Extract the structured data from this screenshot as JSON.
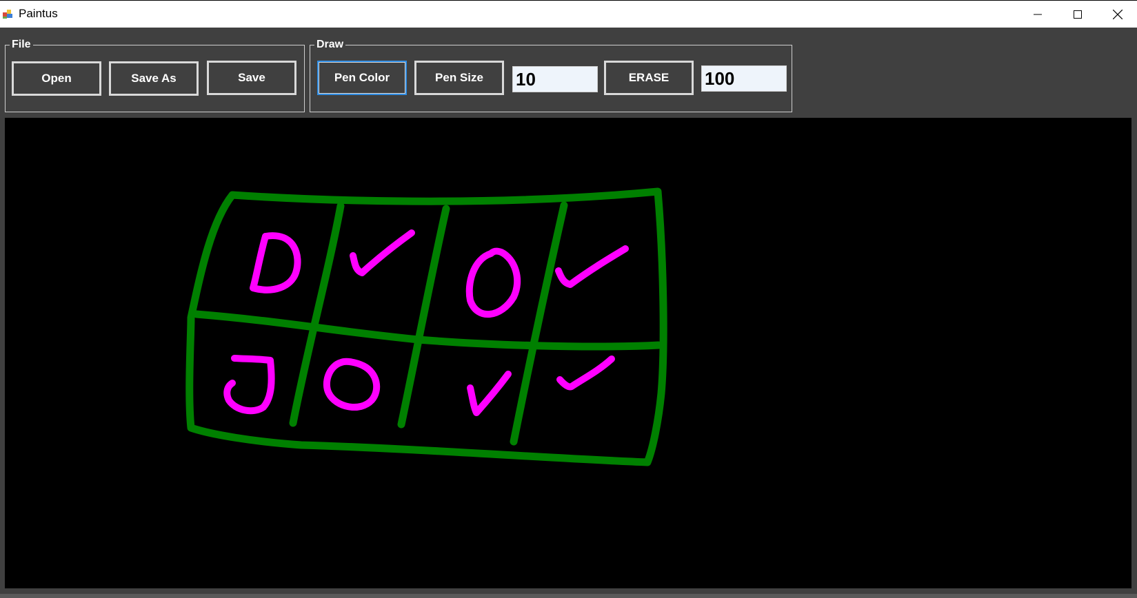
{
  "window": {
    "title": "Paintus",
    "icon": "paint-app-icon",
    "controls": [
      "minimize-icon",
      "maximize-icon",
      "close-icon"
    ]
  },
  "file_group": {
    "legend": "File",
    "open_label": "Open",
    "save_as_label": "Save As",
    "save_label": "Save"
  },
  "draw_group": {
    "legend": "Draw",
    "pen_color_label": "Pen Color",
    "pen_size_label": "Pen Size",
    "pen_size_value": "10",
    "erase_label": "ERASE",
    "erase_size_value": "100"
  },
  "canvas": {
    "background": "#000000",
    "grid_color": "#008000",
    "mark_color": "#ff00ff",
    "drawing_content": "hand-drawn 4x2 grid with letters D, O, J, O and check marks"
  },
  "colors": {
    "window_bg": "#404040",
    "focus_border": "#2f8de4",
    "button_border": "#d9d9d9"
  }
}
